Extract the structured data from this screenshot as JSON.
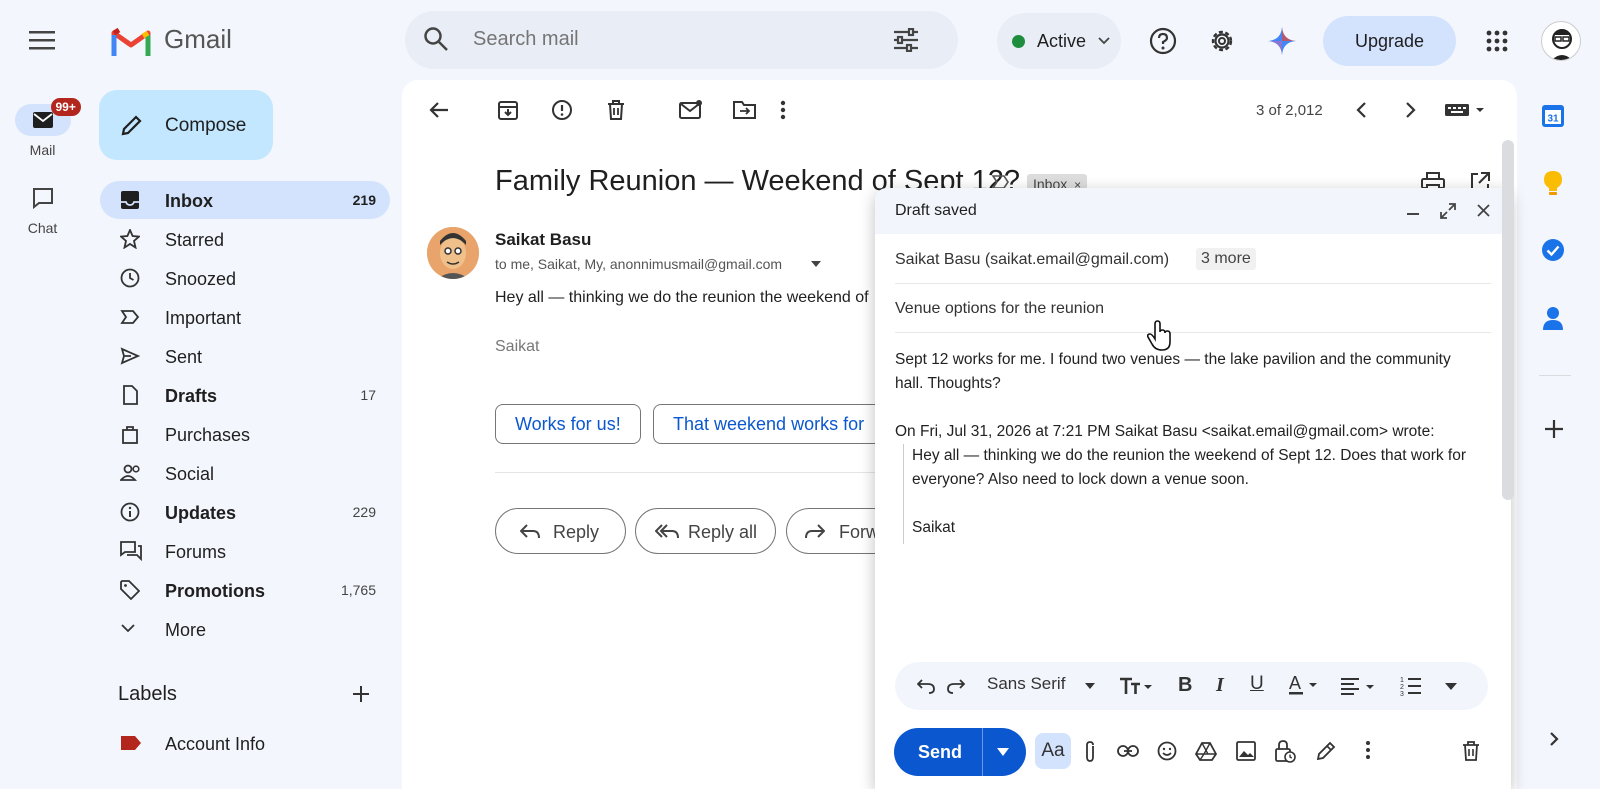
{
  "app": {
    "name": "Gmail"
  },
  "rail": {
    "mail_label": "Mail",
    "chat_label": "Chat",
    "mail_badge": "99+"
  },
  "search": {
    "placeholder": "Search mail"
  },
  "status": {
    "label": "Active",
    "color": "#1e8e3e"
  },
  "upgrade_label": "Upgrade",
  "compose_label": "Compose",
  "nav": [
    {
      "label": "Inbox",
      "count": "219"
    },
    {
      "label": "Starred",
      "count": ""
    },
    {
      "label": "Snoozed",
      "count": ""
    },
    {
      "label": "Important",
      "count": ""
    },
    {
      "label": "Sent",
      "count": ""
    },
    {
      "label": "Drafts",
      "count": "17"
    },
    {
      "label": "Purchases",
      "count": ""
    },
    {
      "label": "Social",
      "count": ""
    },
    {
      "label": "Updates",
      "count": "229"
    },
    {
      "label": "Forums",
      "count": ""
    },
    {
      "label": "Promotions",
      "count": "1,765"
    },
    {
      "label": "More",
      "count": ""
    }
  ],
  "labels": {
    "heading": "Labels",
    "items": [
      {
        "label": "Account Info",
        "color": "#b3261e"
      }
    ]
  },
  "toolbar": {
    "pagination": "3 of 2,012"
  },
  "email": {
    "subject": "Family Reunion — Weekend of Sept 12?",
    "label_chip": "Inbox",
    "sender": "Saikat Basu",
    "recipients": "to me, Saikat, My, anonnimusmail@gmail.com",
    "body_preview": "Hey all — thinking we do the reunion the weekend of",
    "signature": "Saikat",
    "smart_replies": [
      "Works for us!",
      "That weekend works for"
    ],
    "actions": {
      "reply": "Reply",
      "reply_all": "Reply all",
      "forward": "Forw"
    }
  },
  "draft": {
    "header": "Draft saved",
    "from": "Saikat Basu (saikat.email@gmail.com)",
    "more_chip": "3 more",
    "subject": "Venue options for the reunion",
    "body_line1": "Sept 12 works for me. I found two venues — the lake pavilion and the community",
    "body_line2": "hall. Thoughts?",
    "quote_header": "On Fri, Jul 31, 2026 at 7:21 PM Saikat Basu <saikat.email@gmail.com> wrote:",
    "quote_line1": "Hey all — thinking we do the reunion the weekend of Sept 12. Does that work for",
    "quote_line2": "everyone? Also need to lock down a venue soon.",
    "quote_sig": "Saikat",
    "font_name": "Sans Serif",
    "send_label": "Send",
    "aa_label": "Aa"
  },
  "right_rail": {
    "calendar_day": "31"
  }
}
